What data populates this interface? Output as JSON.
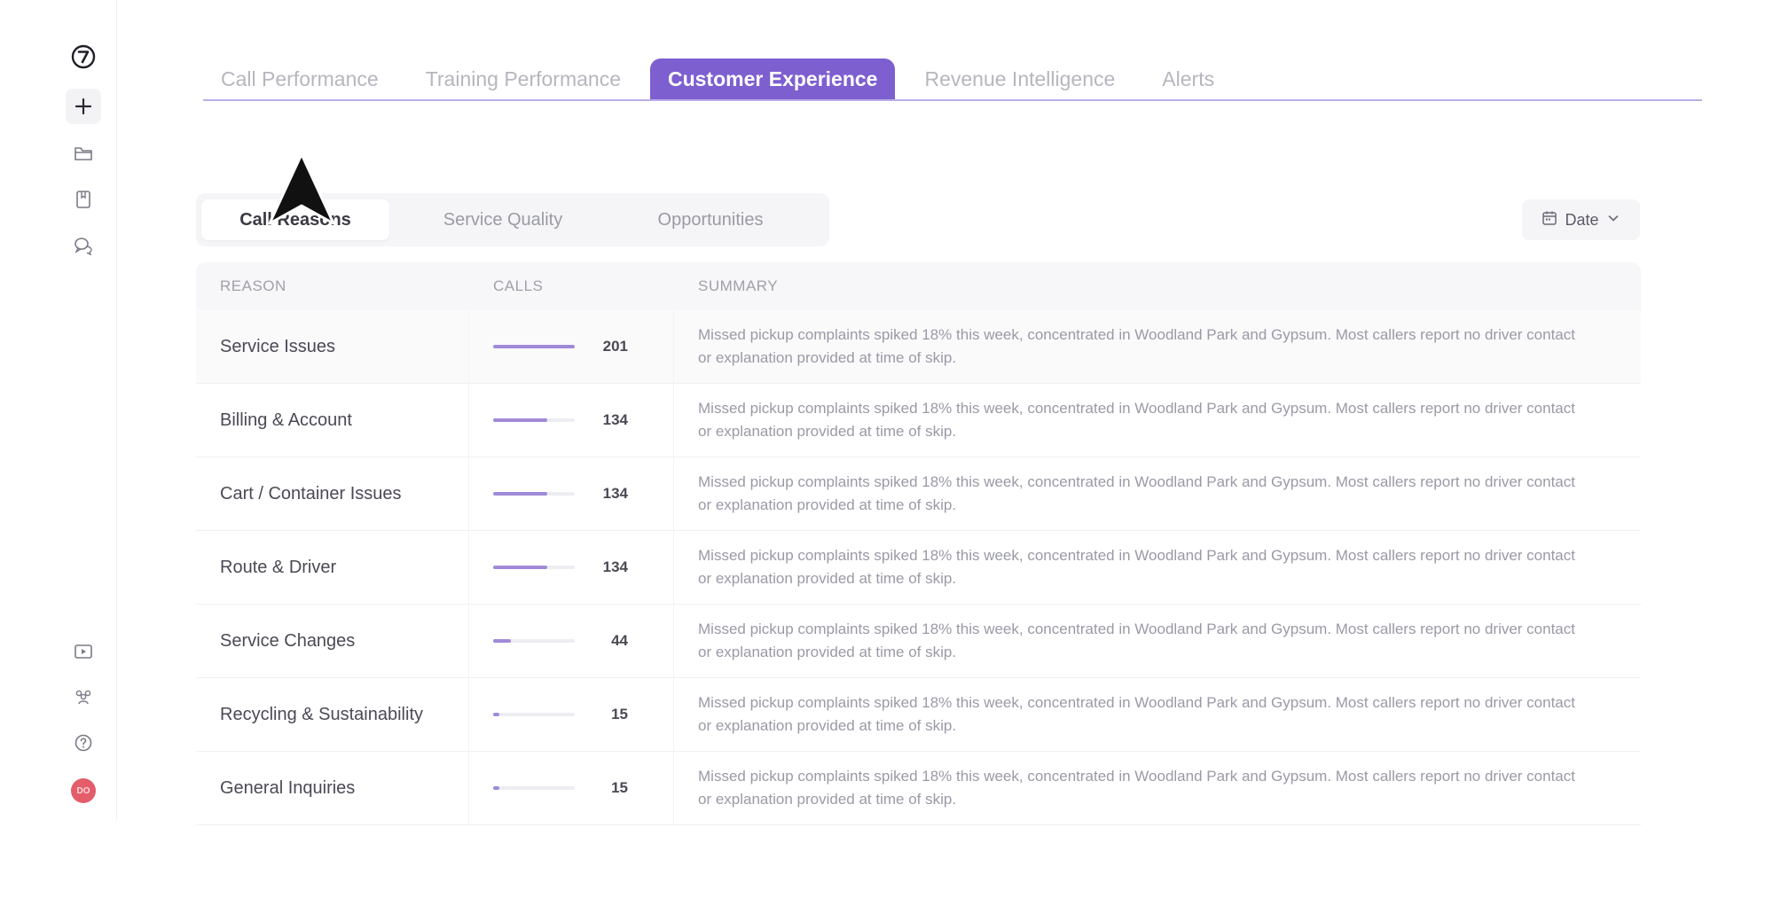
{
  "rail": {
    "logo": "⑦",
    "avatar_initials": "DO",
    "avatar_color": "#e35d6a"
  },
  "top_tabs": [
    {
      "label": "Call Performance",
      "active": false
    },
    {
      "label": "Training Performance",
      "active": false
    },
    {
      "label": "Customer Experience",
      "active": true
    },
    {
      "label": "Revenue Intelligence",
      "active": false
    },
    {
      "label": "Alerts",
      "active": false
    }
  ],
  "sub_tabs": [
    {
      "label": "Call Reasons",
      "active": true
    },
    {
      "label": "Service Quality",
      "active": false
    },
    {
      "label": "Opportunities",
      "active": false
    }
  ],
  "date_filter": {
    "label": "Date",
    "icon": "calendar-icon"
  },
  "table": {
    "headers": {
      "reason": "REASON",
      "calls": "CALLS",
      "summary": "SUMMARY"
    },
    "max_calls": 201,
    "rows": [
      {
        "reason": "Service Issues",
        "calls": 201,
        "summary": "Missed pickup complaints spiked 18% this week, concentrated in Woodland Park and Gypsum. Most callers report no driver contact or explanation provided at time of skip."
      },
      {
        "reason": "Billing & Account",
        "calls": 134,
        "summary": "Missed pickup complaints spiked 18% this week, concentrated in Woodland Park and Gypsum. Most callers report no driver contact or explanation provided at time of skip."
      },
      {
        "reason": "Cart / Container Issues",
        "calls": 134,
        "summary": "Missed pickup complaints spiked 18% this week, concentrated in Woodland Park and Gypsum. Most callers report no driver contact or explanation provided at time of skip."
      },
      {
        "reason": "Route & Driver",
        "calls": 134,
        "summary": "Missed pickup complaints spiked 18% this week, concentrated in Woodland Park and Gypsum. Most callers report no driver contact or explanation provided at time of skip."
      },
      {
        "reason": "Service Changes",
        "calls": 44,
        "summary": "Missed pickup complaints spiked 18% this week, concentrated in Woodland Park and Gypsum. Most callers report no driver contact or explanation provided at time of skip."
      },
      {
        "reason": "Recycling & Sustainability",
        "calls": 15,
        "summary": "Missed pickup complaints spiked 18% this week, concentrated in Woodland Park and Gypsum. Most callers report no driver contact or explanation provided at time of skip."
      },
      {
        "reason": "General Inquiries",
        "calls": 15,
        "summary": "Missed pickup complaints spiked 18% this week, concentrated in Woodland Park and Gypsum. Most callers report no driver contact or explanation provided at time of skip."
      }
    ]
  },
  "colors": {
    "accent": "#7d5fd0",
    "bar": "#a08ad8"
  }
}
